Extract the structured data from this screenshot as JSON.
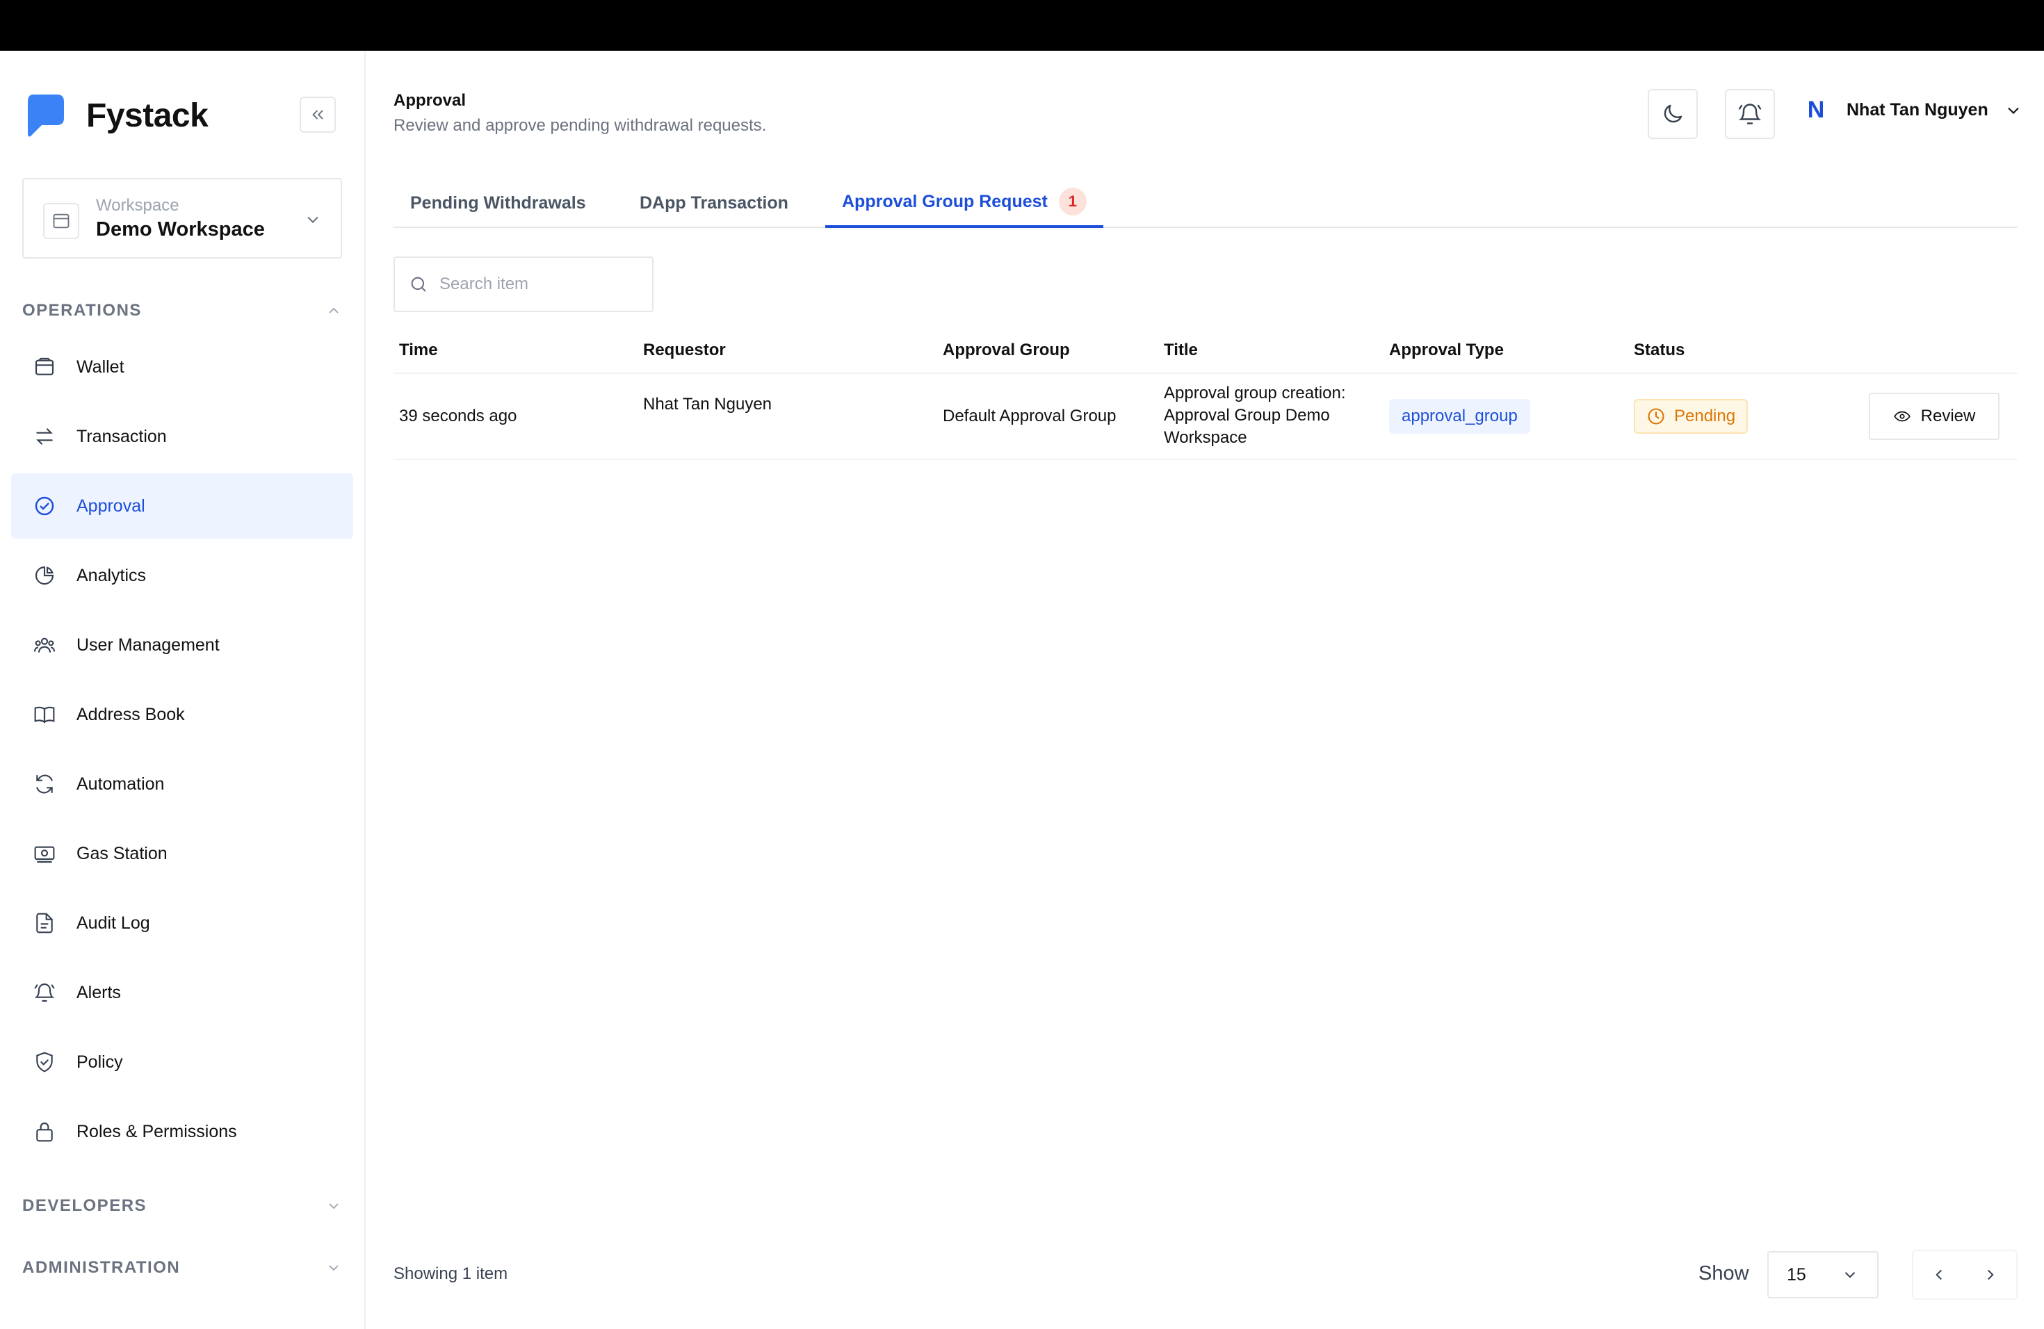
{
  "app": {
    "brand": "Fystack"
  },
  "workspace": {
    "label": "Workspace",
    "name": "Demo Workspace"
  },
  "sidebar": {
    "operations_label": "OPERATIONS",
    "developers_label": "DEVELOPERS",
    "administration_label": "ADMINISTRATION",
    "items": [
      {
        "label": "Wallet",
        "icon": "wallet-icon"
      },
      {
        "label": "Transaction",
        "icon": "arrows-swap-icon"
      },
      {
        "label": "Approval",
        "icon": "check-circle-icon",
        "active": true
      },
      {
        "label": "Analytics",
        "icon": "pie-chart-icon"
      },
      {
        "label": "User Management",
        "icon": "users-icon"
      },
      {
        "label": "Address Book",
        "icon": "book-icon"
      },
      {
        "label": "Automation",
        "icon": "refresh-icon"
      },
      {
        "label": "Gas Station",
        "icon": "banknote-icon"
      },
      {
        "label": "Audit Log",
        "icon": "file-icon"
      },
      {
        "label": "Alerts",
        "icon": "bell-icon"
      },
      {
        "label": "Policy",
        "icon": "shield-icon"
      },
      {
        "label": "Roles & Permissions",
        "icon": "lock-icon"
      }
    ]
  },
  "header": {
    "title": "Approval",
    "subtitle": "Review and approve pending withdrawal requests.",
    "user_initial": "N",
    "user_name": "Nhat Tan Nguyen"
  },
  "tabs": [
    {
      "label": "Pending Withdrawals"
    },
    {
      "label": "DApp Transaction"
    },
    {
      "label": "Approval Group Request",
      "badge": "1",
      "active": true
    }
  ],
  "search": {
    "placeholder": "Search item",
    "value": ""
  },
  "table": {
    "columns": [
      "Time",
      "Requestor",
      "Approval Group",
      "Title",
      "Approval Type",
      "Status"
    ],
    "rows": [
      {
        "time": "39 seconds ago",
        "requestor": "Nhat Tan Nguyen",
        "approval_group": "Default Approval Group",
        "title_lines": [
          "Approval group creation:",
          "Approval Group Demo",
          "Workspace"
        ],
        "approval_type": "approval_group",
        "status": "Pending",
        "action": "Review"
      }
    ]
  },
  "footer": {
    "showing": "Showing 1 item",
    "show_label": "Show",
    "page_size": "15"
  },
  "colors": {
    "accent": "#1d4ed8",
    "active_bg": "#eef4ff",
    "pending": "#d97706",
    "badge_bg": "#fde2dc",
    "badge_text": "#dc2626"
  }
}
